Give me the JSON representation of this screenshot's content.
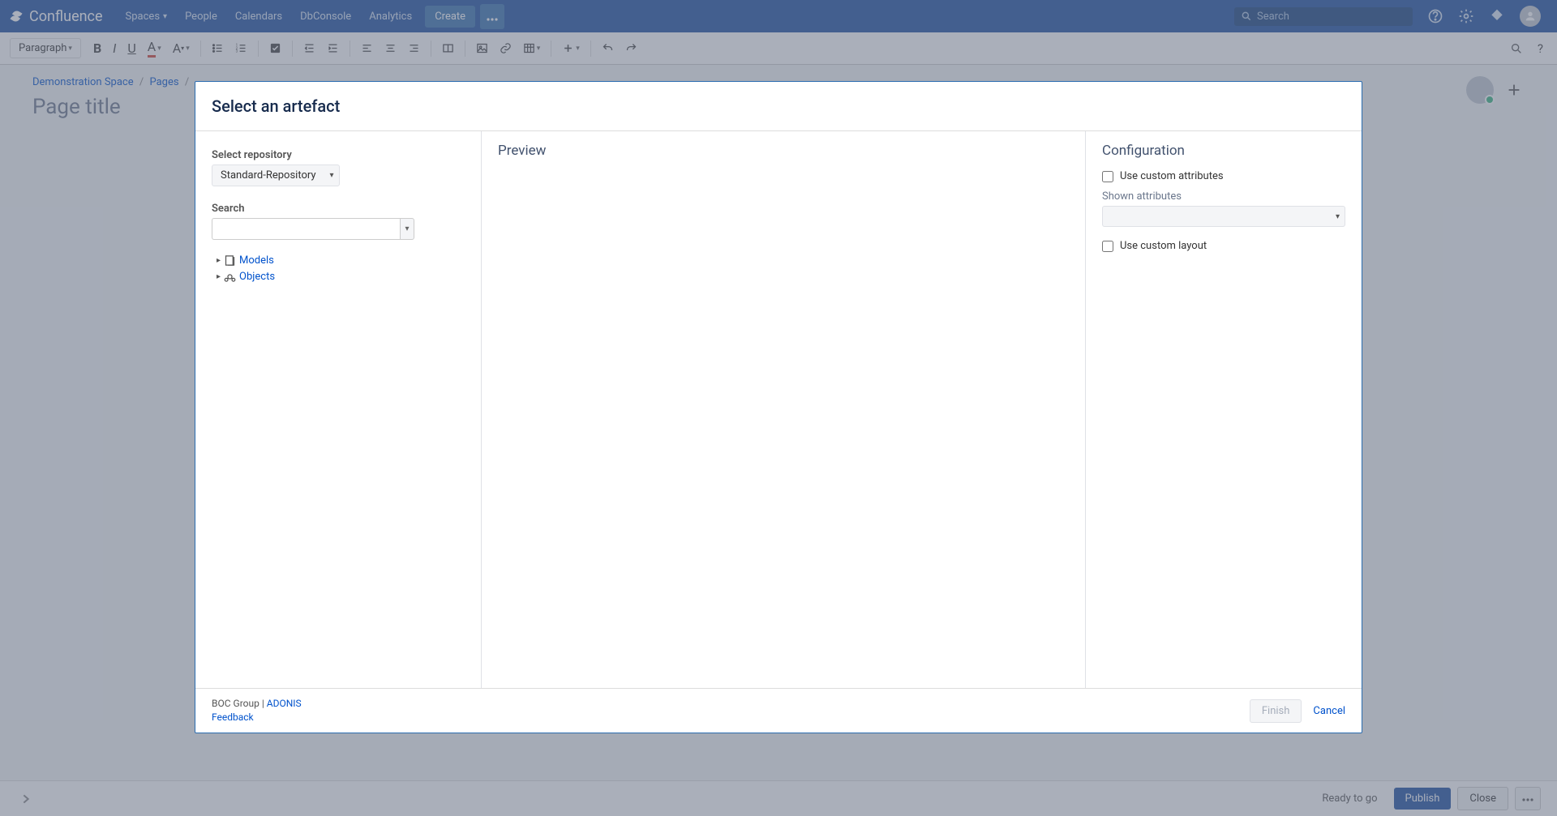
{
  "topnav": {
    "app_name": "Confluence",
    "items": [
      "Spaces",
      "People",
      "Calendars",
      "DbConsole",
      "Analytics"
    ],
    "create": "Create",
    "search_placeholder": "Search"
  },
  "toolbar": {
    "paragraph": "Paragraph"
  },
  "breadcrumb": {
    "space": "Demonstration Space",
    "pages": "Pages"
  },
  "page": {
    "title": "Page title"
  },
  "footer": {
    "status": "Ready to go",
    "publish": "Publish",
    "close": "Close"
  },
  "dialog": {
    "title": "Select an artefact",
    "left": {
      "select_repository_label": "Select repository",
      "repository_value": "Standard-Repository",
      "search_label": "Search",
      "tree": {
        "models": "Models",
        "objects": "Objects"
      }
    },
    "preview_title": "Preview",
    "config": {
      "title": "Configuration",
      "use_custom_attributes": "Use custom attributes",
      "shown_attributes_label": "Shown attributes",
      "use_custom_layout": "Use custom layout"
    },
    "footer": {
      "company": "BOC Group",
      "sep": " | ",
      "product": "ADONIS",
      "feedback": "Feedback",
      "finish": "Finish",
      "cancel": "Cancel"
    }
  }
}
